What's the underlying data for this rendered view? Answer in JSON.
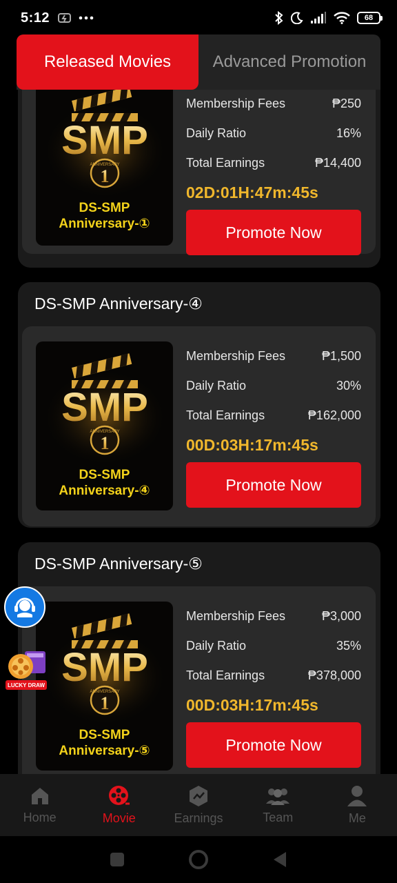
{
  "status_bar": {
    "time": "5:12",
    "battery": "68"
  },
  "tabs": [
    {
      "label": "Released Movies",
      "active": true
    },
    {
      "label": "Advanced Promotion",
      "active": false
    }
  ],
  "labels": {
    "fees": "Membership Fees",
    "ratio": "Daily Ratio",
    "earnings": "Total Earnings",
    "promote": "Promote Now"
  },
  "movies": [
    {
      "poster_line1": "DS-SMP",
      "poster_line2": "Anniversary-①",
      "fees": "₱250",
      "ratio": "16%",
      "earnings": "₱14,400",
      "countdown": "02D:01H:47m:45s"
    },
    {
      "title": "DS-SMP Anniversary-④",
      "poster_line1": "DS-SMP",
      "poster_line2": "Anniversary-④",
      "fees": "₱1,500",
      "ratio": "30%",
      "earnings": "₱162,000",
      "countdown": "00D:03H:17m:45s"
    },
    {
      "title": "DS-SMP Anniversary-⑤",
      "poster_line1": "DS-SMP",
      "poster_line2": "Anniversary-⑤",
      "fees": "₱3,000",
      "ratio": "35%",
      "earnings": "₱378,000",
      "countdown": "00D:03H:17m:45s"
    }
  ],
  "poster_logo": "SMP",
  "poster_badge_number": "1",
  "poster_badge_text": "ANNIVERSARY",
  "lucky_draw": "LUCKY DRAW",
  "nav": [
    {
      "label": "Home",
      "icon": "home-icon",
      "active": false
    },
    {
      "label": "Movie",
      "icon": "film-reel-icon",
      "active": true
    },
    {
      "label": "Earnings",
      "icon": "earnings-icon",
      "active": false
    },
    {
      "label": "Team",
      "icon": "team-icon",
      "active": false
    },
    {
      "label": "Me",
      "icon": "person-icon",
      "active": false
    }
  ],
  "colors": {
    "accent": "#e3121b",
    "gold": "#f0b72c",
    "background": "#000000",
    "card": "#1b1b1b"
  }
}
